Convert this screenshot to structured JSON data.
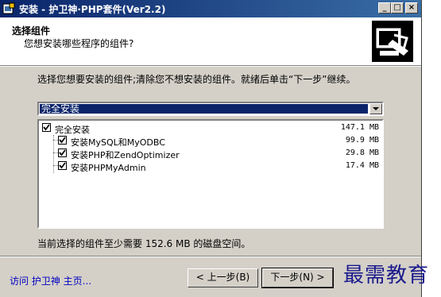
{
  "window": {
    "title": "安装 - 护卫神·PHP套件(Ver2.2)",
    "controls": [
      "_",
      "□",
      "×"
    ]
  },
  "header": {
    "title": "选择组件",
    "subtitle": "您想安装哪些程序的组件?"
  },
  "instructions": "选择您想要安装的组件;清除您不想安装的组件。就绪后单击“下一步”继续。",
  "install_type": {
    "selected": "完全安装"
  },
  "components": [
    {
      "label": "完全安装",
      "size": "147.1 MB",
      "checked": true
    },
    {
      "label": "安装MySQL和MyODBC",
      "size": "99.9 MB",
      "checked": true
    },
    {
      "label": "安装PHP和ZendOptimizer",
      "size": "29.8 MB",
      "checked": true
    },
    {
      "label": "安装PHPMyAdmin",
      "size": "17.4 MB",
      "checked": true
    }
  ],
  "disk_space": "当前选择的组件至少需要 152.6 MB 的磁盘空间。",
  "footer": {
    "link": "访问 护卫神 主页...",
    "back_label": "< 上一步(B)",
    "next_label": "下一步(N) >"
  },
  "watermark": "最需教育"
}
